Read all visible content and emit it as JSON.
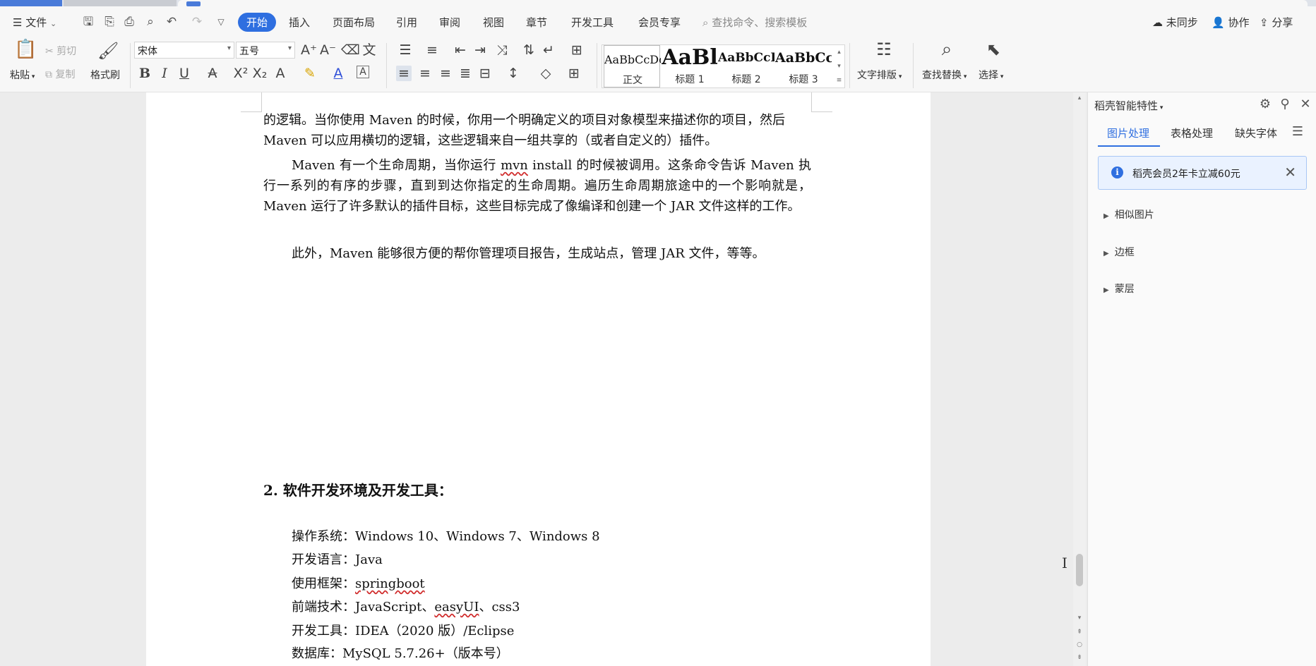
{
  "menu": {
    "file": "文件",
    "tabs": [
      "开始",
      "插入",
      "页面布局",
      "引用",
      "审阅",
      "视图",
      "章节",
      "开发工具",
      "会员专享"
    ],
    "search_placeholder": "查找命令、搜索模板",
    "sync": "未同步",
    "collab": "协作",
    "share": "分享"
  },
  "ribbon": {
    "paste": "粘贴",
    "cut": "剪切",
    "copy": "复制",
    "format_painter": "格式刷",
    "font_name": "宋体",
    "font_size": "五号",
    "styles": [
      {
        "sample": "AaBbCcDc",
        "label": "正文"
      },
      {
        "sample": "AaBl",
        "label": "标题 1"
      },
      {
        "sample": "AaBbCcD",
        "label": "标题 2"
      },
      {
        "sample": "AaBbCcI",
        "label": "标题 3"
      }
    ],
    "text_layout": "文字排版",
    "find_replace": "查找替换",
    "select": "选择"
  },
  "document": {
    "p1_line1": "的逻辑。当你使用 Maven 的时候，你用一个明确定义的项目对象模型来描述你的项目，然后",
    "p1_line2": "Maven 可以应用横切的逻辑，这些逻辑来自一组共享的（或者自定义的）插件。",
    "p2_a": "Maven 有一个生命周期，当你运行 ",
    "p2_mvn": "mvn",
    "p2_b": " install 的时候被调用。这条命令告诉 Maven 执行一系列的有序的步骤，直到到达你指定的生命周期。遍历生命周期旅途中的一个影响就是，Maven 运行了许多默认的插件目标，这些目标完成了像编译和创建一个 JAR 文件这样的工作。",
    "p3": "此外，Maven 能够很方便的帮你管理项目报告，生成站点，管理 JAR 文件，等等。",
    "heading": "2. 软件开发环境及开发工具：",
    "env": {
      "os": "操作系统：Windows 10、Windows 7、Windows 8",
      "lang": "开发语言：Java",
      "framework_label": "使用框架：",
      "framework": "springboot",
      "frontend_a": "前端技术：JavaScript、",
      "frontend_b": "easyUI",
      "frontend_c": "、css3",
      "tools": "开发工具：IDEA（2020 版）/Eclipse",
      "db": "数据库：MySQL 5.7.26+（版本号）"
    }
  },
  "panel": {
    "title": "稻壳智能特性",
    "tabs": [
      "图片处理",
      "表格处理",
      "缺失字体"
    ],
    "promo": "稻壳会员2年卡立减60元",
    "sections": [
      "相似图片",
      "边框",
      "蒙层"
    ]
  }
}
